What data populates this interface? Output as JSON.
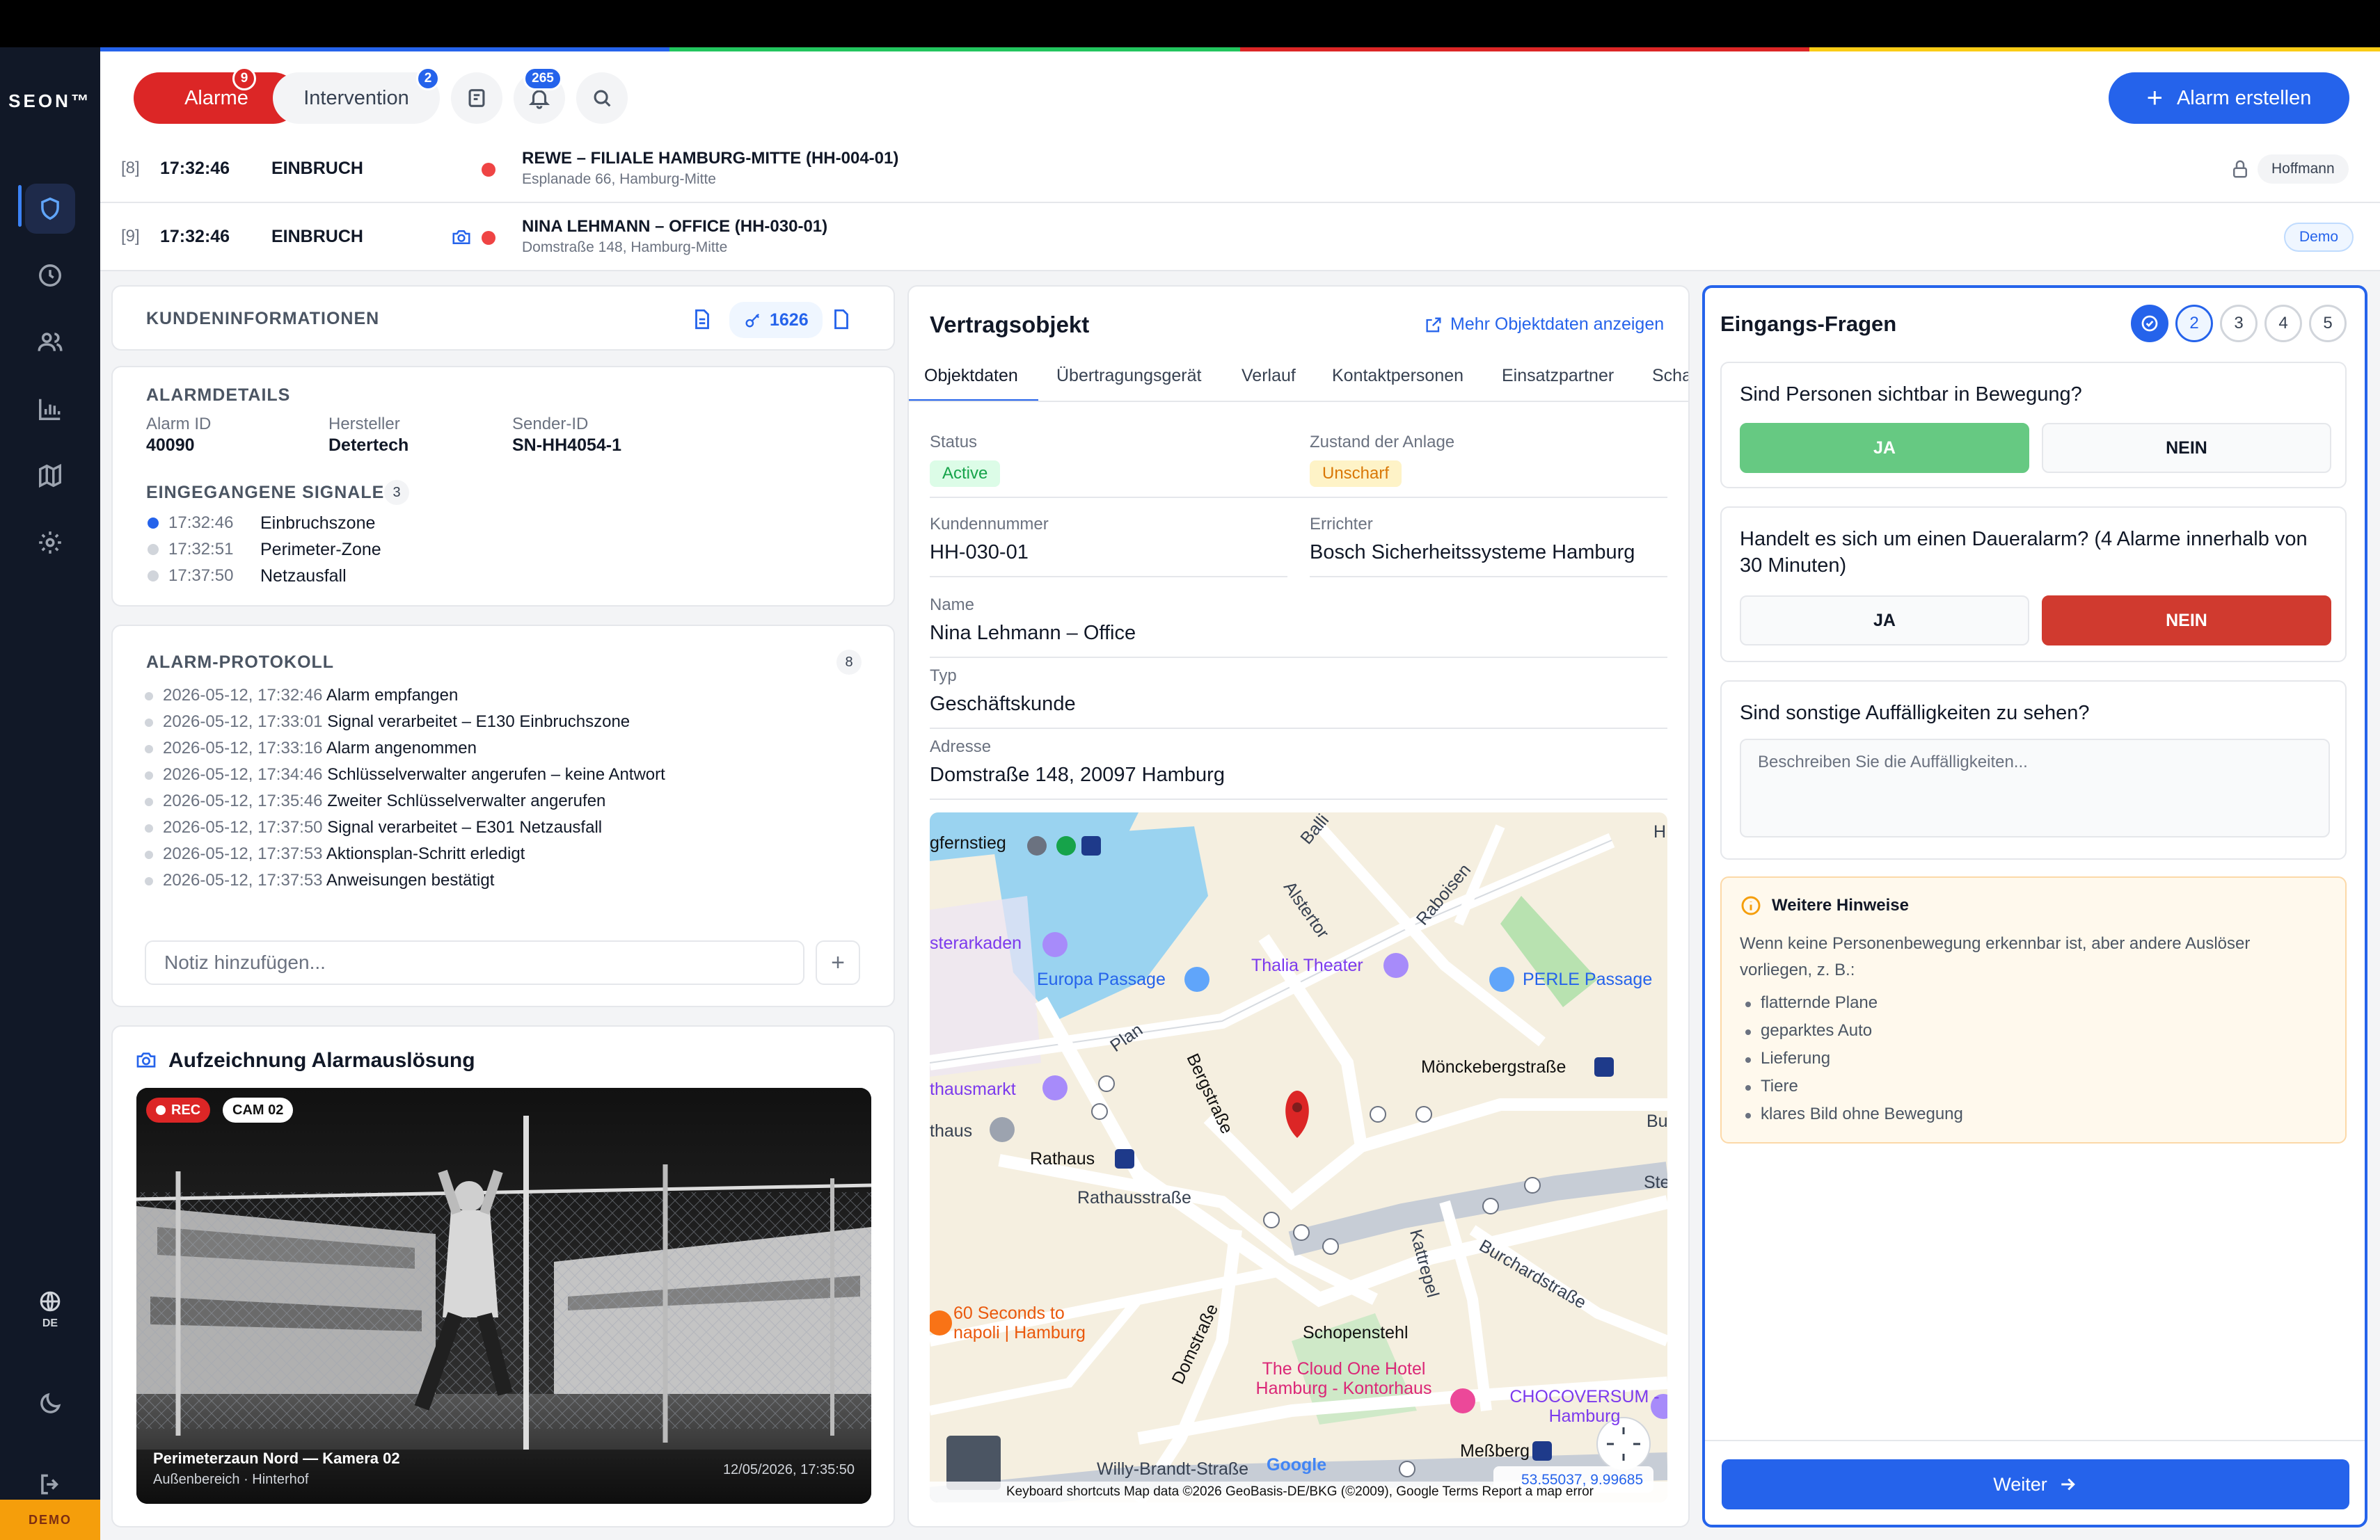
{
  "brand": {
    "logo": "SEON™"
  },
  "stripes": {
    "c1": "#2563eb",
    "c2": "#22c55e",
    "c3": "#dc2626",
    "c4": "#facc15"
  },
  "sidebar": {
    "items": [
      {
        "icon": "shield-icon"
      },
      {
        "icon": "clock-icon"
      },
      {
        "icon": "users-icon"
      },
      {
        "icon": "chart-icon"
      },
      {
        "icon": "map-icon"
      },
      {
        "icon": "gear-icon"
      }
    ],
    "language": "DE",
    "demo": "DEMO"
  },
  "header": {
    "alarme_label": "Alarme",
    "alarme_count": "9",
    "intervention_label": "Intervention",
    "intervention_count": "2",
    "notifications_count": "265",
    "create_alarm": "Alarm erstellen"
  },
  "alarm_rows": [
    {
      "idx": "[8]",
      "time": "17:32:46",
      "type": "EINBRUCH",
      "name": "REWE – FILIALE HAMBURG-MITTE (HH-004-01)",
      "address": "Esplanade 66, Hamburg-Mitte",
      "tag": "Hoffmann"
    },
    {
      "idx": "[9]",
      "time": "17:32:46",
      "type": "EINBRUCH",
      "name": "NINA LEHMANN – OFFICE (HH-030-01)",
      "address": "Domstraße 148, Hamburg-Mitte",
      "tag": "Demo"
    }
  ],
  "kunden": {
    "title": "KUNDENINFORMATIONEN",
    "key_count": "1626"
  },
  "alarmdetails": {
    "title": "ALARMDETAILS",
    "alarm_id_label": "Alarm ID",
    "alarm_id": "40090",
    "hersteller_label": "Hersteller",
    "hersteller": "Detertech",
    "sender_label": "Sender-ID",
    "sender": "SN-HH4054-1",
    "signals_title": "EINGEGANGENE SIGNALE",
    "signals_count": "3",
    "signals": [
      {
        "time": "17:32:46",
        "name": "Einbruchszone"
      },
      {
        "time": "17:32:51",
        "name": "Perimeter-Zone"
      },
      {
        "time": "17:37:50",
        "name": "Netzausfall"
      }
    ]
  },
  "protokoll": {
    "title": "ALARM-PROTOKOLL",
    "count": "8",
    "entries": [
      {
        "time": "2026-05-12, 17:32:46",
        "text": "Alarm empfangen"
      },
      {
        "time": "2026-05-12, 17:33:01",
        "text": "Signal verarbeitet – E130 Einbruchszone"
      },
      {
        "time": "2026-05-12, 17:33:16",
        "text": "Alarm angenommen"
      },
      {
        "time": "2026-05-12, 17:34:46",
        "text": "Schlüsselverwalter angerufen – keine Antwort"
      },
      {
        "time": "2026-05-12, 17:35:46",
        "text": "Zweiter Schlüsselverwalter angerufen"
      },
      {
        "time": "2026-05-12, 17:37:50",
        "text": "Signal verarbeitet – E301 Netzausfall"
      },
      {
        "time": "2026-05-12, 17:37:53",
        "text": "Aktionsplan-Schritt erledigt"
      },
      {
        "time": "2026-05-12, 17:37:53",
        "text": "Anweisungen bestätigt"
      }
    ],
    "note_placeholder": "Notiz hinzufügen..."
  },
  "recording": {
    "title": "Aufzeichnung Alarmauslösung",
    "rec": "REC",
    "cam": "CAM 02",
    "camera_name": "Perimeterzaun Nord — Kamera 02",
    "location": "Außenbereich · Hinterhof",
    "timestamp": "12/05/2026, 17:35:50"
  },
  "vertragsobjekt": {
    "title": "Vertragsobjekt",
    "more_link": "Mehr Objektdaten anzeigen",
    "tabs": [
      "Objektdaten",
      "Übertragungsgerät",
      "Verlauf",
      "Kontaktpersonen",
      "Einsatzpartner",
      "Scha"
    ],
    "status_label": "Status",
    "status": "Active",
    "zustand_label": "Zustand der Anlage",
    "zustand": "Unscharf",
    "kunden_label": "Kundennummer",
    "kunden": "HH-030-01",
    "errichter_label": "Errichter",
    "errichter": "Bosch Sicherheitssysteme Hamburg",
    "name_label": "Name",
    "name": "Nina Lehmann – Office",
    "typ_label": "Typ",
    "typ": "Geschäftskunde",
    "adresse_label": "Adresse",
    "adresse": "Domstraße 148, 20097 Hamburg"
  },
  "map": {
    "labels": {
      "jungfernstieg": "gfernstieg",
      "ballin": "Balli",
      "h": "H",
      "alstertor": "Alstertor",
      "raboisen": "Raboisen",
      "arkaden": "sterarkaden",
      "thalia": "Thalia Theater",
      "europa": "Europa Passage",
      "perle": "PERLE Passage",
      "plan": "Plan",
      "bergstrasse": "Bergstraße",
      "rathausmarkt": "thausmarkt",
      "moenck": "Mönckebergstraße",
      "rathaus1": "thaus",
      "rathaus2": "Rathaus",
      "bu": "Bu",
      "rathausstrasse": "Rathausstraße",
      "ste": "Ste",
      "kattrepel": "Kattrepel",
      "burchard": "Burchardstraße",
      "seconds": "60 Seconds to napoli | Hamburg",
      "domstrasse": "Domstraße",
      "schopenstehl": "Schopenstehl",
      "cloud": "The Cloud One Hotel Hamburg - Kontorhaus",
      "choco": "CHOCOVERSUM - Hamburg",
      "messberg": "Meßberg",
      "willy": "Willy-Brandt-Straße",
      "google": "Google",
      "coords": "53.55037, 9.99685",
      "attribution": "Keyboard shortcuts   Map data ©2026 GeoBasis-DE/BKG (©2009), Google   Terms   Report a map error"
    }
  },
  "questions": {
    "title": "Eingangs-Fragen",
    "steps": [
      "2",
      "3",
      "4",
      "5"
    ],
    "q1": "Sind Personen sichtbar in Bewegung?",
    "q2": "Handelt es sich um einen Daueralarm? (4 Alarme innerhalb von 30 Minuten)",
    "q3": "Sind sonstige Auffälligkeiten zu sehen?",
    "yes": "JA",
    "no": "NEIN",
    "q3_placeholder": "Beschreiben Sie die Auffälligkeiten...",
    "hint_title": "Weitere Hinweise",
    "hint_text": "Wenn keine Personenbewegung erkennbar ist, aber andere Auslöser vorliegen, z. B.:",
    "hint_items": [
      "flatternde Plane",
      "geparktes Auto",
      "Lieferung",
      "Tiere",
      "klares Bild ohne Bewegung"
    ],
    "next": "Weiter"
  }
}
